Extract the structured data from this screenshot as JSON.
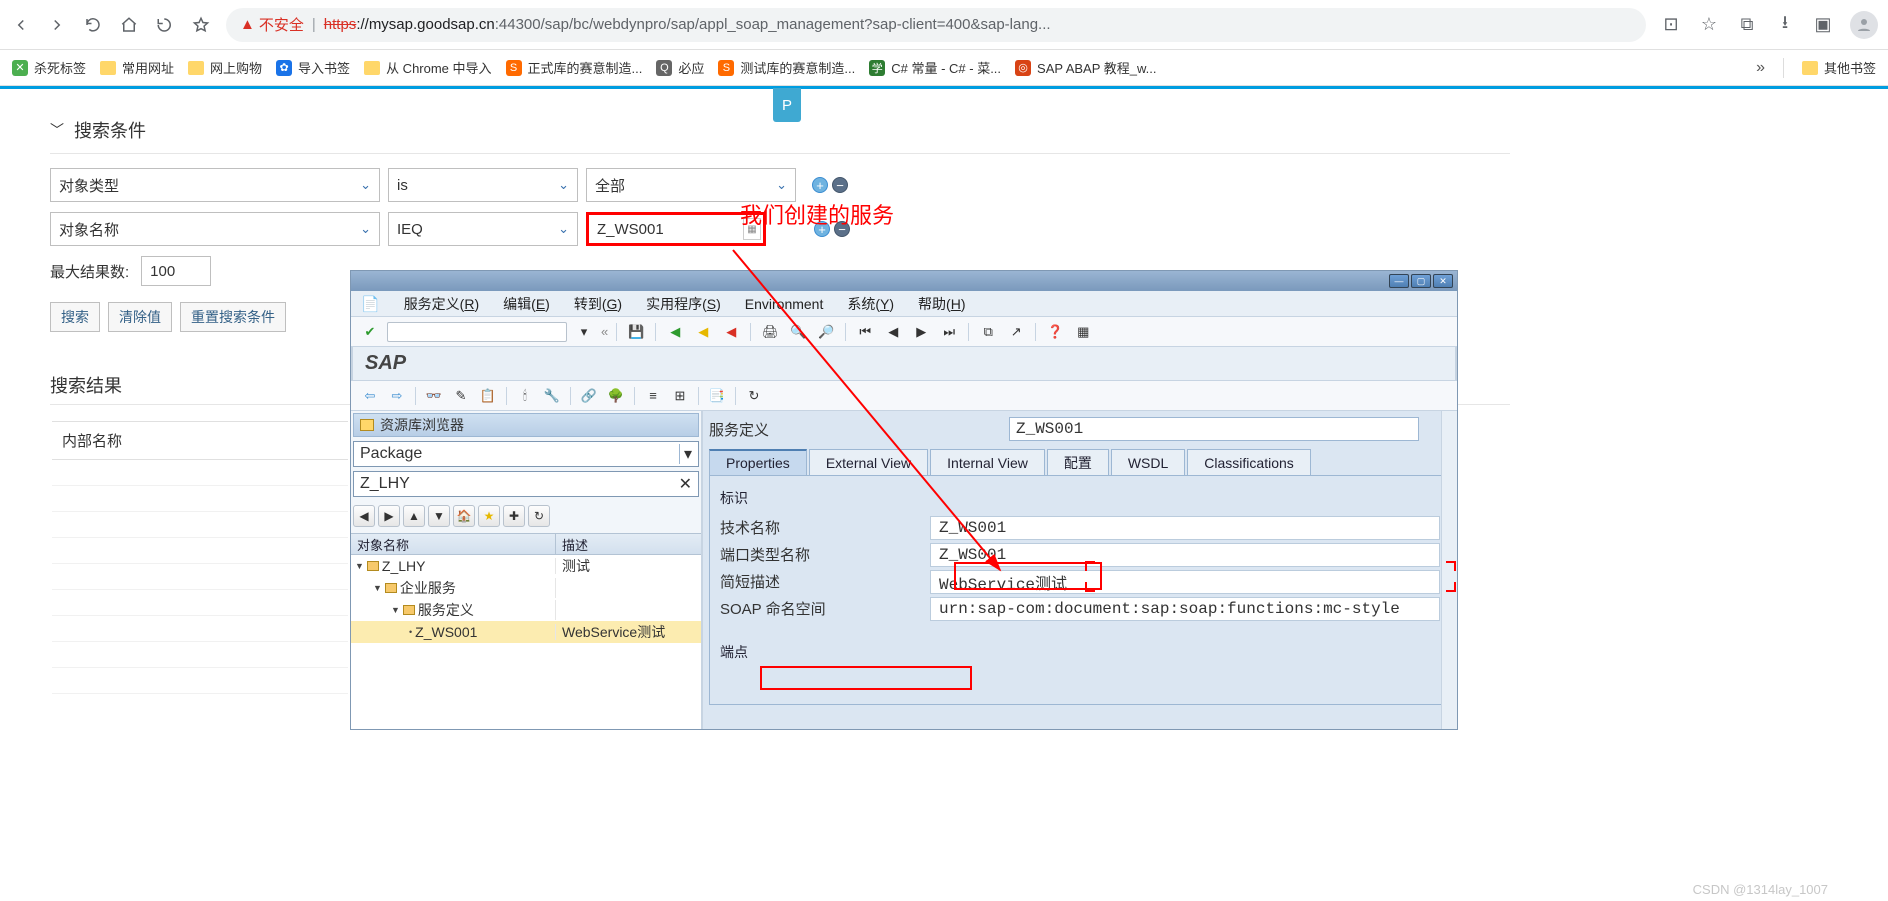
{
  "browser": {
    "insecure_label": "不安全",
    "url_https": "https",
    "url_domain": "://mysap.goodsap.cn",
    "url_path": ":44300/sap/bc/webdynpro/sap/appl_soap_management?sap-client=400&sap-lang..."
  },
  "bookmarks": {
    "b1": "杀死标签",
    "b2": "常用网址",
    "b3": "网上购物",
    "b4": "导入书签",
    "b5": "从 Chrome 中导入",
    "b6": "正式库的赛意制造...",
    "b7": "必应",
    "b8": "测试库的赛意制造...",
    "b9": "C# 常量 - C# - 菜...",
    "b10": "SAP ABAP 教程_w...",
    "more": "»",
    "other": "其他书签"
  },
  "search": {
    "title": "搜索条件",
    "row1_field": "对象类型",
    "row1_op": "is",
    "row1_val": "全部",
    "row2_field": "对象名称",
    "row2_op": "IEQ",
    "row2_val": "Z_WS001",
    "max_label": "最大结果数:",
    "max_val": "100",
    "btn_search": "搜索",
    "btn_clear": "清除值",
    "btn_reset": "重置搜索条件"
  },
  "annotation": "我们创建的服务",
  "results": {
    "title": "搜索结果",
    "col1": "内部名称"
  },
  "sapgui": {
    "menu": {
      "m1a": "服务定义(",
      "m1u": "R",
      "m1b": ")",
      "m2a": "编辑(",
      "m2u": "E",
      "m2b": ")",
      "m3a": "转到(",
      "m3u": "G",
      "m3b": ")",
      "m4a": "实用程序(",
      "m4u": "S",
      "m4b": ")",
      "m5": "Environment",
      "m6a": "系统(",
      "m6u": "Y",
      "m6b": ")",
      "m7a": "帮助(",
      "m7u": "H",
      "m7b": ")"
    },
    "logo": "SAP",
    "left": {
      "repo_title": "资源库浏览器",
      "package_select": "Package",
      "package_input": "Z_LHY",
      "col_obj": "对象名称",
      "col_desc": "描述",
      "tree": [
        {
          "indent": 0,
          "name": "Z_LHY",
          "desc": "测试",
          "expand": "▼",
          "folder": true
        },
        {
          "indent": 1,
          "name": "企业服务",
          "desc": "",
          "expand": "▼",
          "folder": true
        },
        {
          "indent": 2,
          "name": "服务定义",
          "desc": "",
          "expand": "▼",
          "folder": true
        },
        {
          "indent": 3,
          "name": "Z_WS001",
          "desc": "WebService测试",
          "expand": "•",
          "folder": false,
          "sel": true
        }
      ]
    },
    "right": {
      "svc_def_label": "服务定义",
      "svc_def_val": "Z_WS001",
      "tabs": [
        "Properties",
        "External View",
        "Internal View",
        "配置",
        "WSDL",
        "Classifications"
      ],
      "group_ident": "标识",
      "rows": [
        {
          "label": "技术名称",
          "value": "Z_WS001",
          "hl": true
        },
        {
          "label": "端口类型名称",
          "value": "Z_WS001"
        },
        {
          "label": "简短描述",
          "value": "WebService测试"
        },
        {
          "label": "SOAP 命名空间",
          "value": "urn:sap-com:document:sap:soap:functions:mc-style"
        }
      ],
      "group_endpoint": "端点"
    }
  },
  "watermark": "CSDN @1314lay_1007"
}
